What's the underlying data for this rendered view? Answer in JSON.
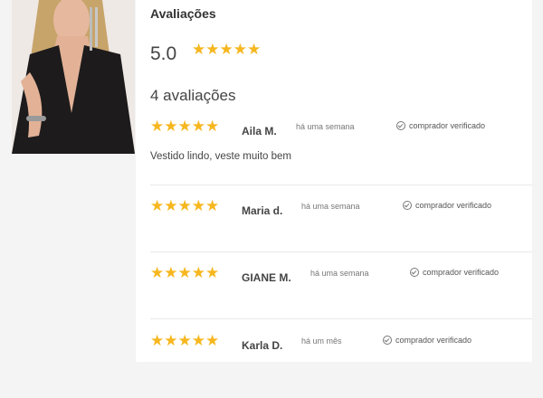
{
  "header": {
    "title": "Avaliações",
    "average_score": "5.0",
    "average_stars": "★★★★★",
    "count_label": "4 avaliações"
  },
  "reviews": [
    {
      "stars": "★★★★★",
      "name": "Aila M.",
      "time": "há uma semana",
      "verified": "comprador verificado",
      "text": "Vestido lindo, veste muito bem"
    },
    {
      "stars": "★★★★★",
      "name": "Maria d.",
      "time": "há uma semana",
      "verified": "comprador verificado",
      "text": ""
    },
    {
      "stars": "★★★★★",
      "name": "GIANE M.",
      "time": "há uma semana",
      "verified": "comprador verificado",
      "text": ""
    },
    {
      "stars": "★★★★★",
      "name": "Karla D.",
      "time": "há um mês",
      "verified": "comprador verificado",
      "text": ""
    }
  ],
  "colors": {
    "star": "#f6b71f",
    "panel": "#ffffff",
    "background": "#f4f4f4"
  },
  "icons": {
    "verified": "check-circle-icon"
  }
}
